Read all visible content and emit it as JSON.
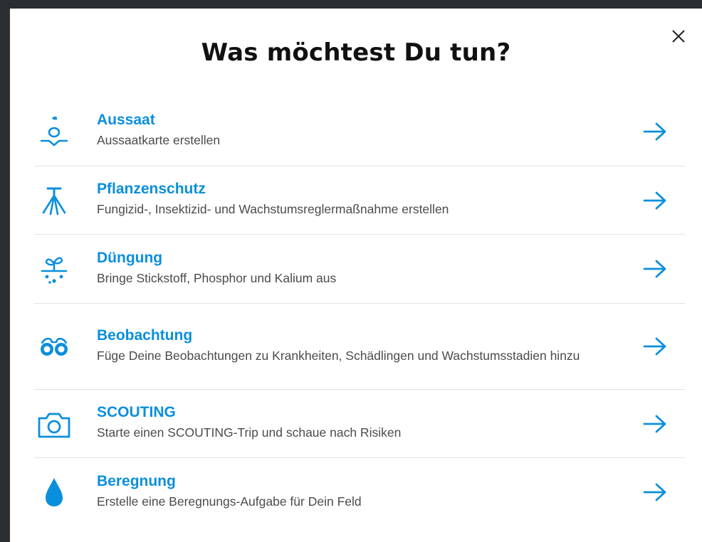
{
  "dialog": {
    "title": "Was möchtest Du tun?",
    "close_icon": "close-icon",
    "colors": {
      "accent": "#0a8fdc",
      "text": "#111111",
      "muted": "#4b4b4b"
    }
  },
  "items": [
    {
      "label": "Aussaat",
      "description": "Aussaatkarte erstellen",
      "icon": "seed-sprout-icon"
    },
    {
      "label": "Pflanzenschutz",
      "description": "Fungizid-, Insektizid- und Wachstumsreglermaßnahme erstellen",
      "icon": "sprayer-icon"
    },
    {
      "label": "Düngung",
      "description": "Bringe Stickstoff, Phosphor und Kalium aus",
      "icon": "fertilizer-plant-icon"
    },
    {
      "label": "Beobachtung",
      "description": "Füge Deine Beobachtungen zu Krankheiten, Schädlingen und Wachstumsstadien hinzu",
      "icon": "binoculars-icon"
    },
    {
      "label": "SCOUTING",
      "description": "Starte einen SCOUTING-Trip und schaue nach Risiken",
      "icon": "camera-icon"
    },
    {
      "label": "Beregnung",
      "description": "Erstelle eine Beregnungs-Aufgabe für Dein Feld",
      "icon": "water-drop-icon"
    }
  ]
}
